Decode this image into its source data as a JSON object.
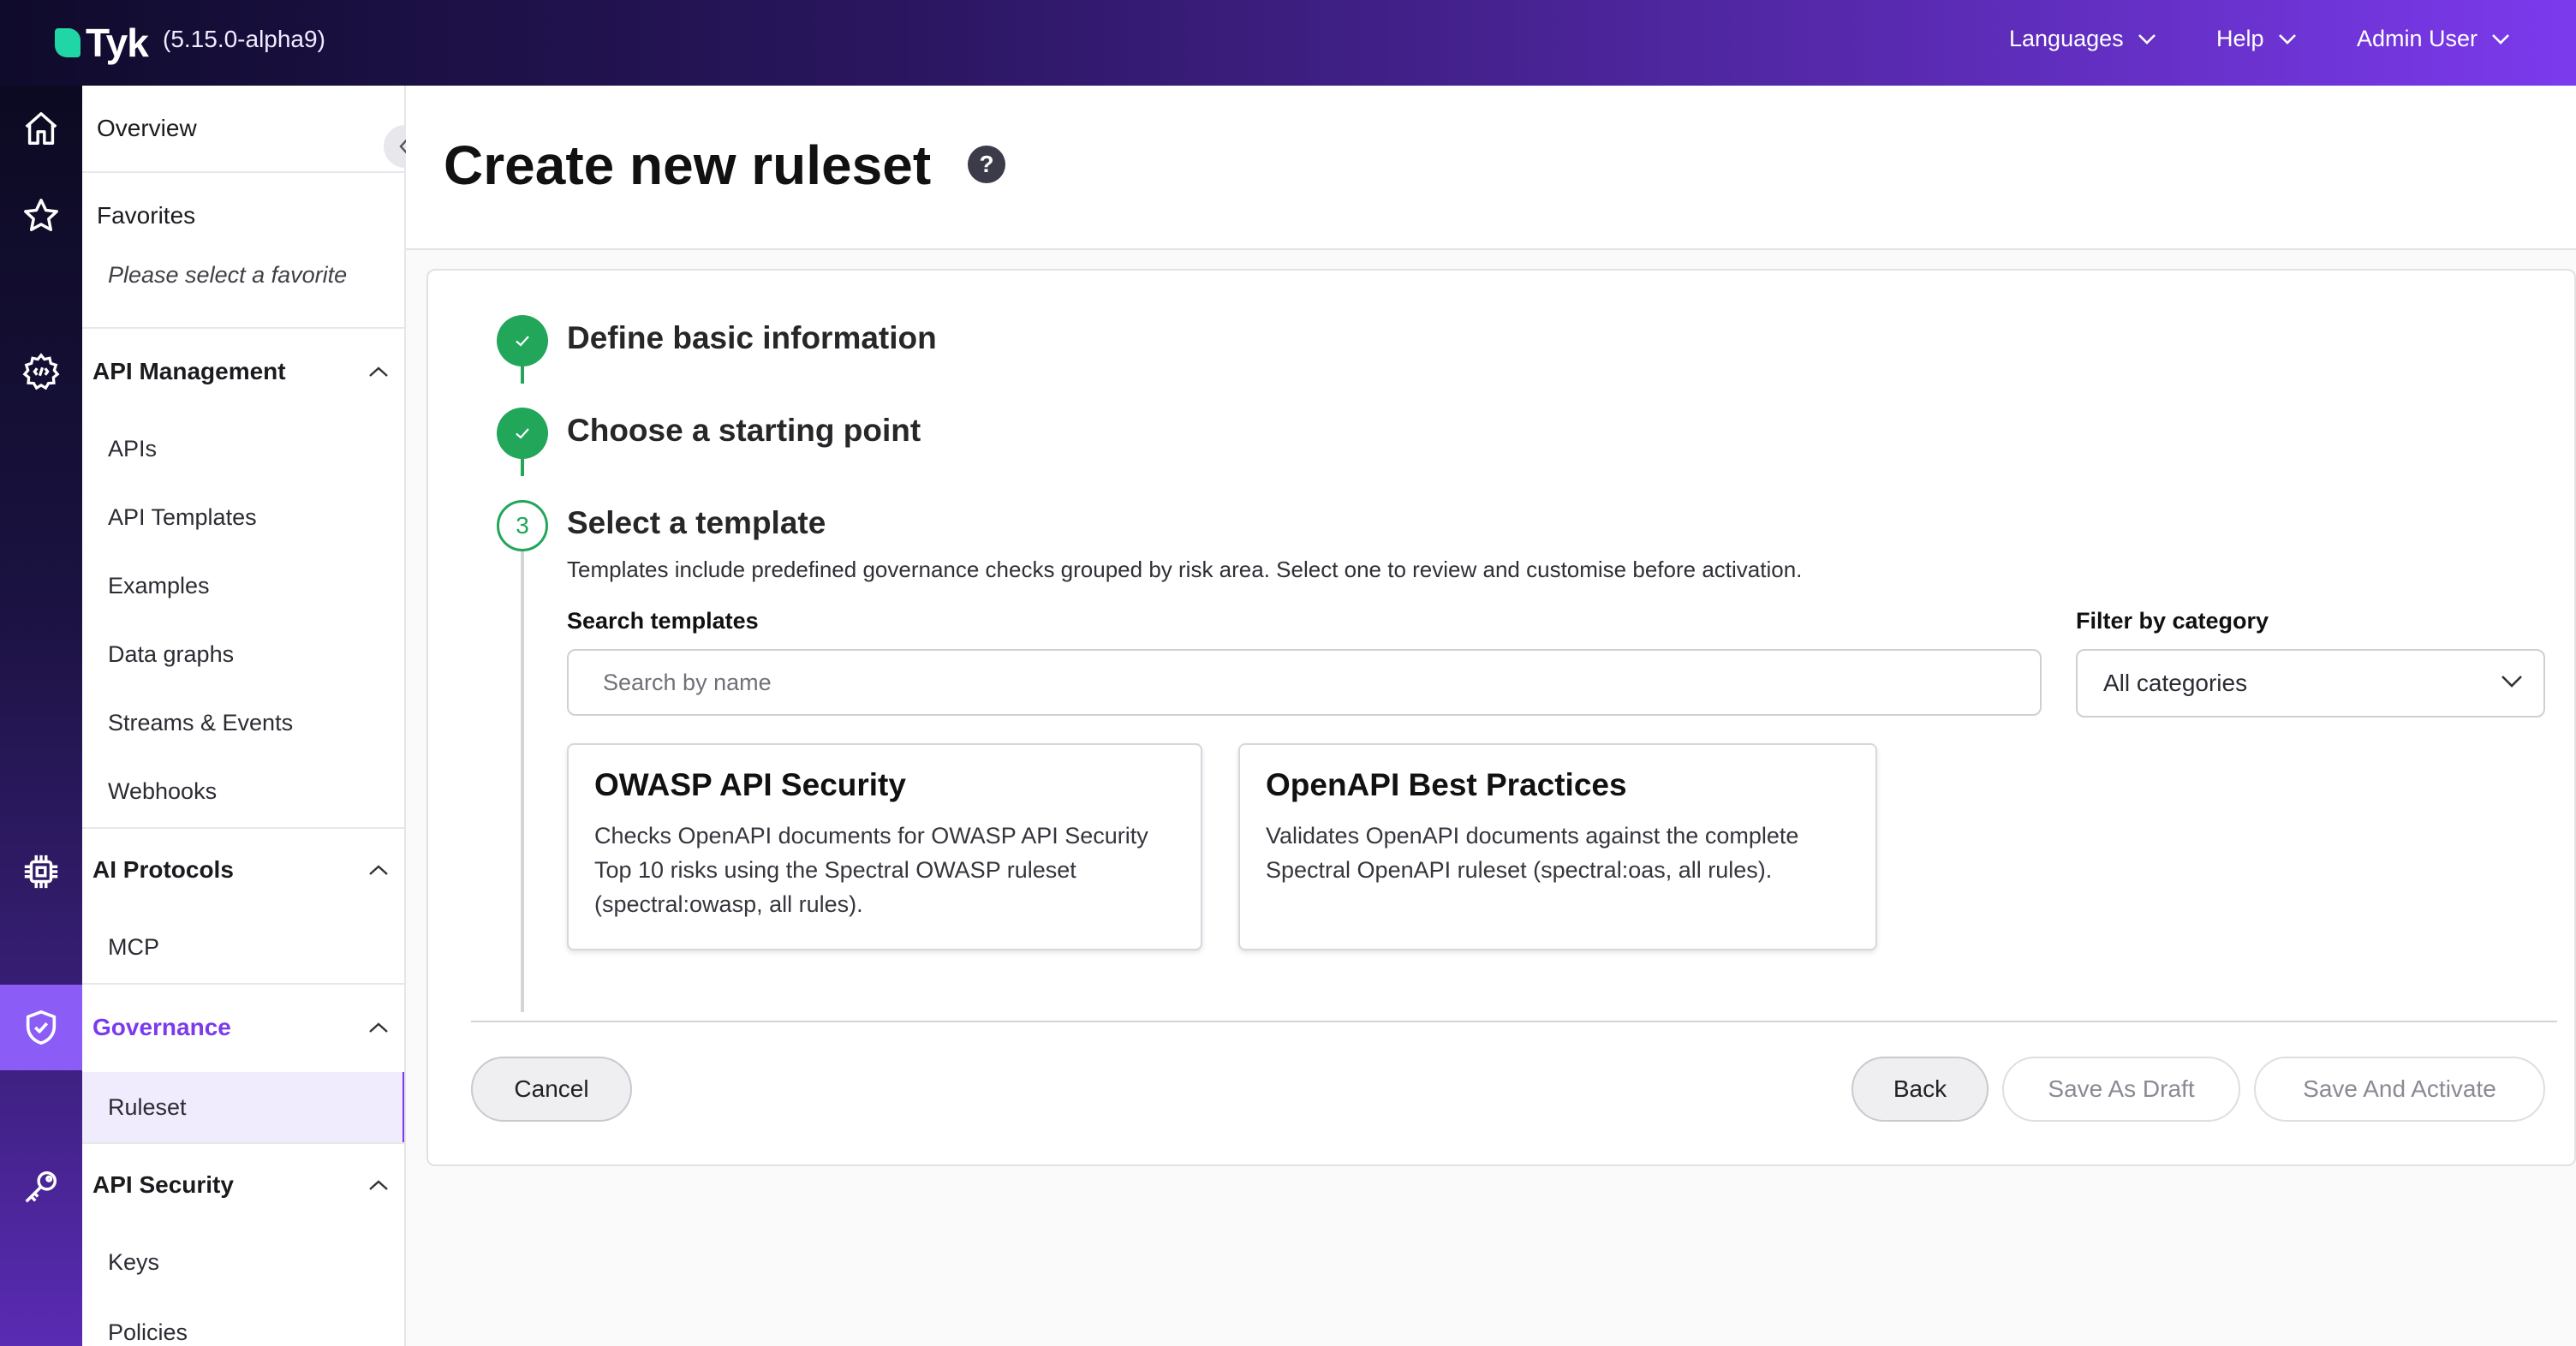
{
  "topbar": {
    "logo_text": "Tyk",
    "version": "(5.15.0-alpha9)",
    "menu": {
      "languages": "Languages",
      "help": "Help",
      "user": "Admin User"
    }
  },
  "sidebar": {
    "overview": "Overview",
    "favorites": "Favorites",
    "favorites_placeholder": "Please select a favorite",
    "api_management": {
      "label": "API Management",
      "items": [
        "APIs",
        "API Templates",
        "Examples",
        "Data graphs",
        "Streams & Events",
        "Webhooks"
      ]
    },
    "ai_protocols": {
      "label": "AI Protocols",
      "items": [
        "MCP"
      ]
    },
    "governance": {
      "label": "Governance",
      "items": [
        "Ruleset"
      ]
    },
    "api_security": {
      "label": "API Security",
      "items": [
        "Keys",
        "Policies"
      ]
    }
  },
  "page": {
    "title": "Create new ruleset",
    "help_glyph": "?"
  },
  "steps": {
    "step1": "Define basic information",
    "step2": "Choose a starting point",
    "step3": {
      "number": "3",
      "title": "Select a template"
    },
    "description": "Templates include predefined governance checks grouped by risk area. Select one to review and customise before activation."
  },
  "search": {
    "label": "Search templates",
    "placeholder": "Search by name"
  },
  "filter": {
    "label": "Filter by category",
    "selected": "All categories"
  },
  "templates": [
    {
      "title": "OWASP API Security",
      "description": "Checks OpenAPI documents for OWASP API Security Top 10 risks using the Spectral OWASP ruleset (spectral:owasp, all rules)."
    },
    {
      "title": "OpenAPI Best Practices",
      "description": "Validates OpenAPI documents against the complete Spectral OpenAPI ruleset (spectral:oas, all rules)."
    }
  ],
  "buttons": {
    "cancel": "Cancel",
    "back": "Back",
    "save_draft": "Save As Draft",
    "save_activate": "Save And Activate"
  },
  "colors": {
    "accent": "#7c3aed",
    "success": "#22a659"
  }
}
